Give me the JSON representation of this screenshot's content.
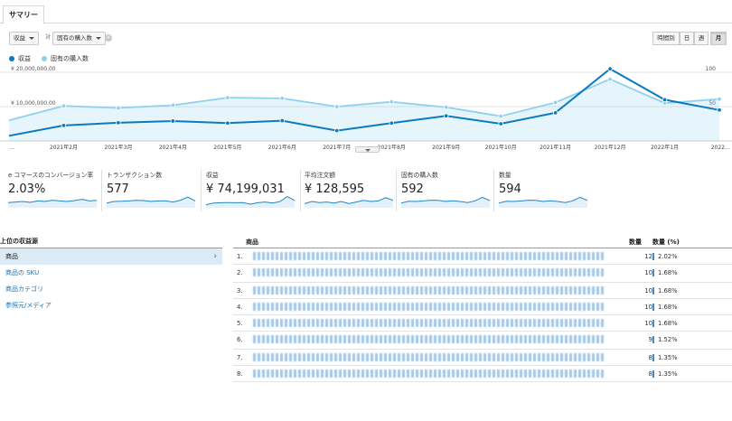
{
  "tab": {
    "label": "サマリー"
  },
  "controls": {
    "metric1": "収益",
    "vs_label": "対",
    "metric2": "固有の購入数",
    "clear": "×",
    "periods": [
      "時間別",
      "日",
      "週",
      "月"
    ],
    "active_period": "月"
  },
  "legend": {
    "series1": {
      "label": "収益",
      "color": "#0b7bc1"
    },
    "series2": {
      "label": "固有の購入数",
      "color": "#8fd0ee"
    }
  },
  "chart_data": {
    "type": "line",
    "x": [
      "…",
      "2021年2月",
      "2021年3月",
      "2021年4月",
      "2021年5月",
      "2021年6月",
      "2021年7月",
      "2021年8月",
      "2021年9月",
      "2021年10月",
      "2021年11月",
      "2021年12月",
      "2022年1月",
      "2022…"
    ],
    "y_left_ticks": [
      "¥ 20,000,000.00",
      "¥ 10,000,000.00"
    ],
    "y_right_ticks": [
      "100",
      "50"
    ],
    "series": [
      {
        "name": "収益",
        "axis": "left",
        "ylim": [
          0,
          20000000
        ],
        "values": [
          1500000,
          4500000,
          5300000,
          5800000,
          5200000,
          5900000,
          3000000,
          5200000,
          7300000,
          5000000,
          8200000,
          21000000,
          12000000,
          9000000
        ]
      },
      {
        "name": "固有の購入数",
        "axis": "right",
        "ylim": [
          0,
          100
        ],
        "values": [
          30,
          51,
          48,
          52,
          63,
          62,
          50,
          57,
          49,
          36,
          56,
          90,
          55,
          61
        ]
      }
    ],
    "grid": true
  },
  "metrics": [
    {
      "label": "e コマースのコンバージョン率",
      "value": "2.03%",
      "spark": [
        0.4,
        0.45,
        0.5,
        0.42,
        0.55,
        0.5,
        0.62,
        0.55,
        0.5,
        0.58,
        0.7,
        0.55,
        0.6
      ]
    },
    {
      "label": "トランザクション数",
      "value": "577",
      "spark": [
        0.35,
        0.5,
        0.52,
        0.55,
        0.6,
        0.58,
        0.5,
        0.55,
        0.55,
        0.45,
        0.62,
        0.9,
        0.55
      ]
    },
    {
      "label": "収益",
      "value": "¥ 74,199,031",
      "spark": [
        0.2,
        0.35,
        0.38,
        0.4,
        0.38,
        0.4,
        0.25,
        0.38,
        0.45,
        0.35,
        0.48,
        0.95,
        0.6
      ]
    },
    {
      "label": "平均注文額",
      "value": "¥ 128,595",
      "spark": [
        0.3,
        0.5,
        0.4,
        0.45,
        0.35,
        0.5,
        0.3,
        0.45,
        0.6,
        0.5,
        0.55,
        0.85,
        0.6
      ]
    },
    {
      "label": "固有の購入数",
      "value": "592",
      "spark": [
        0.35,
        0.52,
        0.5,
        0.55,
        0.62,
        0.6,
        0.5,
        0.56,
        0.5,
        0.4,
        0.56,
        0.88,
        0.58
      ]
    },
    {
      "label": "数量",
      "value": "594",
      "spark": [
        0.35,
        0.52,
        0.5,
        0.55,
        0.62,
        0.6,
        0.5,
        0.56,
        0.5,
        0.4,
        0.56,
        0.88,
        0.6
      ]
    }
  ],
  "left_panel": {
    "header": "上位の収益源",
    "items": [
      "商品",
      "商品の SKU",
      "商品カテゴリ",
      "参照元/メディア"
    ],
    "active_index": 0
  },
  "table": {
    "header_name": "商品",
    "header_qty": "数量",
    "header_qty_pct": "数量 (%)",
    "rows": [
      {
        "num": "1.",
        "qty": "12",
        "pct": "2.02%"
      },
      {
        "num": "2.",
        "qty": "10",
        "pct": "1.68%"
      },
      {
        "num": "3.",
        "qty": "10",
        "pct": "1.68%"
      },
      {
        "num": "4.",
        "qty": "10",
        "pct": "1.68%"
      },
      {
        "num": "5.",
        "qty": "10",
        "pct": "1.68%"
      },
      {
        "num": "6.",
        "qty": "9",
        "pct": "1.52%"
      },
      {
        "num": "7.",
        "qty": "8",
        "pct": "1.35%"
      },
      {
        "num": "8.",
        "qty": "8",
        "pct": "1.35%"
      }
    ]
  }
}
